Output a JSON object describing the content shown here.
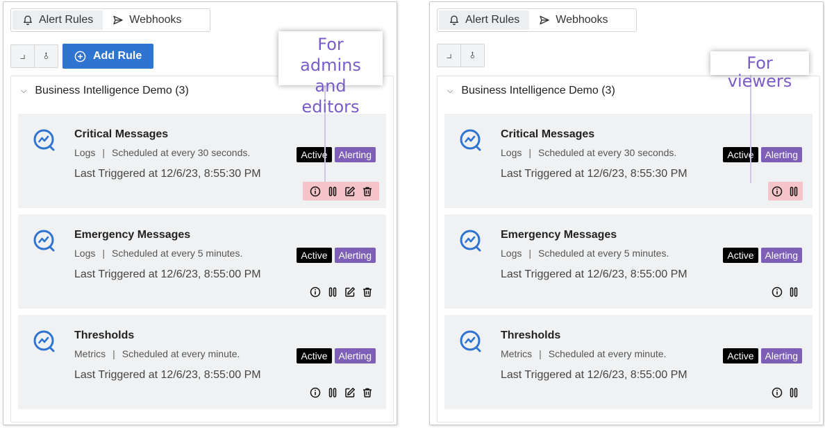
{
  "tabs": [
    {
      "label": "Alert Rules",
      "icon": "bell-icon",
      "active": true
    },
    {
      "label": "Webhooks",
      "icon": "send-icon",
      "active": false
    }
  ],
  "add_rule_label": "Add Rule",
  "folder": {
    "name": "Business Intelligence Demo (3)"
  },
  "cards": [
    {
      "title": "Critical Messages",
      "type": "Logs",
      "schedule": "Scheduled at every 30 seconds.",
      "last": "Last Triggered at 12/6/23, 8:55:30 PM",
      "badges": [
        "Active",
        "Alerting"
      ]
    },
    {
      "title": "Emergency Messages",
      "type": "Logs",
      "schedule": "Scheduled at every 5 minutes.",
      "last": "Last Triggered at 12/6/23, 8:55:00 PM",
      "badges": [
        "Active",
        "Alerting"
      ]
    },
    {
      "title": "Thresholds",
      "type": "Metrics",
      "schedule": "Scheduled at every minute.",
      "last": "Last Triggered at 12/6/23, 8:55:00 PM",
      "badges": [
        "Active",
        "Alerting"
      ]
    }
  ],
  "callouts": {
    "admins_line1": "For admins",
    "admins_line2": "and editors",
    "viewers": "For viewers"
  },
  "colors": {
    "accent": "#2f74d0",
    "alerting": "#7e5fb7",
    "active_badge": "#000000",
    "highlight": "#f5c4c8",
    "callout_text": "#7a5cc9"
  }
}
